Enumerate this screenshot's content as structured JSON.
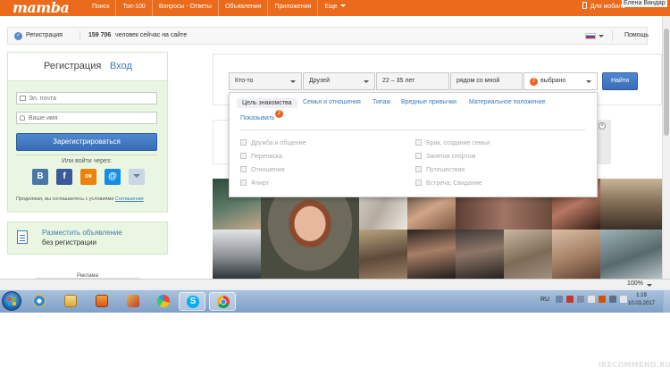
{
  "brand": {
    "logo": "mamba"
  },
  "topnav": {
    "items": [
      "Поиск",
      "Топ-100",
      "Вопросы - Ответы",
      "Объявления",
      "Приложения",
      "Еще"
    ],
    "mobile": "Для мобиль",
    "windows_user": "Елена Вандар"
  },
  "statusbar": {
    "register": "Регистрация",
    "online_count": "159 706",
    "online_text": "человек сейчас на сайте",
    "help": "Помощь"
  },
  "reg_panel": {
    "tab_register": "Регистрация",
    "tab_login": "Вход",
    "email_placeholder": "Эл. почта",
    "name_placeholder": "Ваше имя",
    "register_button": "Зарегистрироваться",
    "login_via": "Или войти через:",
    "social": [
      "В",
      "f",
      "ок",
      "@"
    ],
    "agree_text": "Продолжая, вы соглашаетесь с условиями",
    "agree_link": "Соглашения"
  },
  "ad_panel": {
    "link": "Разместить объявление",
    "sub": "без регистрации",
    "ads_label": "Реклама"
  },
  "search": {
    "who": "Кто-то",
    "purpose": "Друзей",
    "age": "22 – 35 лет",
    "location": "рядом со мной",
    "selected_count": "2",
    "selected_label": "выбрано",
    "find_button": "Найти"
  },
  "dropdown": {
    "tabs": [
      "Цель знакомства",
      "Семья и отношения",
      "Типаж",
      "Вредные привычки",
      "Материальное положение"
    ],
    "show": "Показывать",
    "show_count": "2",
    "options_left": [
      "Дружба и общение",
      "Переписка",
      "Отношения",
      "Флирт"
    ],
    "options_right": [
      "Брак, создание семьи",
      "Занятия спортом",
      "Путешествия",
      "Встреча, Свидание"
    ]
  },
  "browser": {
    "zoom": "100%"
  },
  "taskbar": {
    "lang": "RU",
    "time": "1:19",
    "date": "10.03.2017"
  },
  "watermark": "iRECOMMEND.RU",
  "colors": {
    "brand_orange": "#e96b1b",
    "link_blue": "#3a7bbf",
    "panel_green": "#e9f6e2",
    "button_blue": "#3a6db5",
    "badge_orange": "#e9631b"
  },
  "icons": [
    "phone-icon",
    "check-icon",
    "flag-ru-icon",
    "user-icon",
    "envelope-icon",
    "document-icon",
    "close-icon",
    "windows-start-icon",
    "ie-icon",
    "explorer-icon",
    "media-player-icon",
    "skype-icon",
    "chrome-icon"
  ]
}
